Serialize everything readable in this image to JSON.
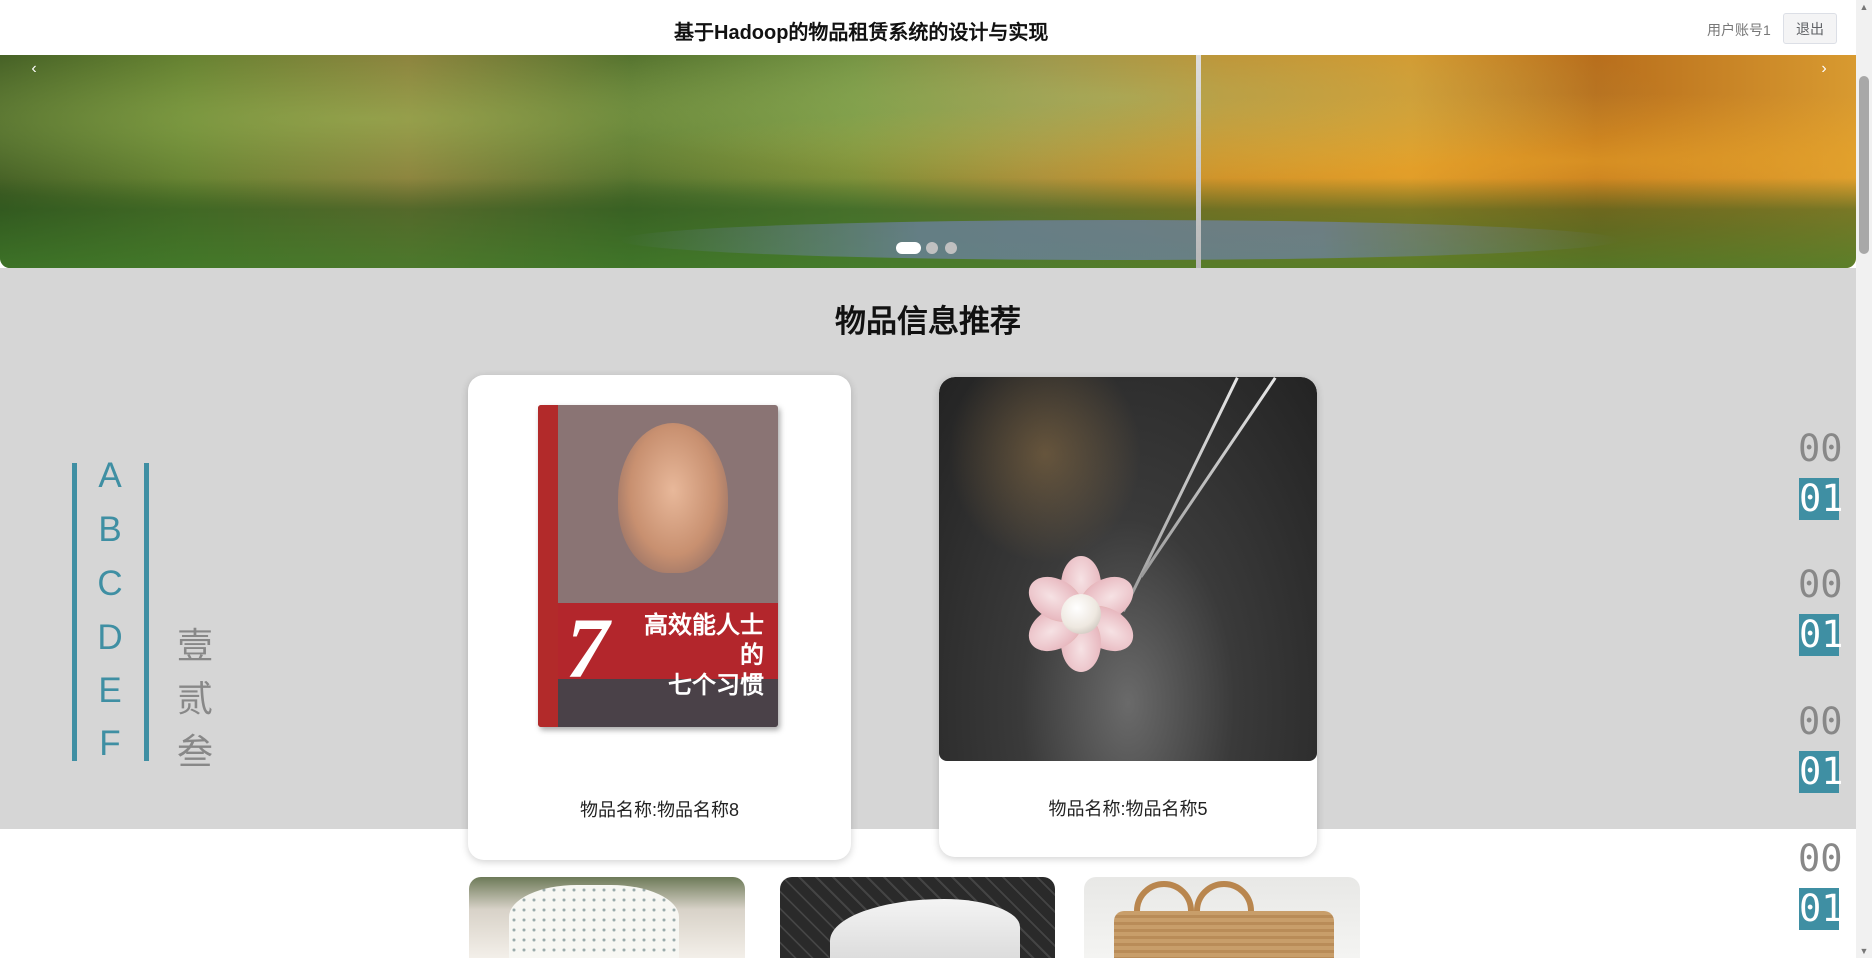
{
  "header": {
    "title": "基于Hadoop的物品租赁系统的设计与实现",
    "user_label": "用户账号1",
    "logout_label": "退出"
  },
  "banner": {
    "prev_icon": "‹",
    "next_icon": "›",
    "slide_count": 3,
    "active_slide": 1
  },
  "recommend": {
    "title": "物品信息推荐",
    "cards": [
      {
        "name": "物品名称:物品名称8",
        "image": "book-cover"
      },
      {
        "name": "物品名称:物品名称5",
        "image": "pearl-flower-necklace"
      }
    ],
    "bottom_row_images": [
      "dotted-dress",
      "white-sneaker",
      "woven-bag"
    ]
  },
  "decor": {
    "letters": [
      "A",
      "B",
      "C",
      "D",
      "E",
      "F"
    ],
    "cn_numbers": [
      "壹",
      "贰",
      "叁"
    ],
    "counters": [
      {
        "top": "00",
        "bottom": "01"
      },
      {
        "top": "00",
        "bottom": "01"
      },
      {
        "top": "00",
        "bottom": "01"
      },
      {
        "top": "00",
        "bottom": "01"
      }
    ]
  },
  "book": {
    "big_number": "7",
    "title_line1": "高效能人士的",
    "title_line2": "七个习惯"
  },
  "colors": {
    "accent": "#3f8fa3",
    "section_bg": "#d6d6d6",
    "muted_text": "#888888"
  }
}
